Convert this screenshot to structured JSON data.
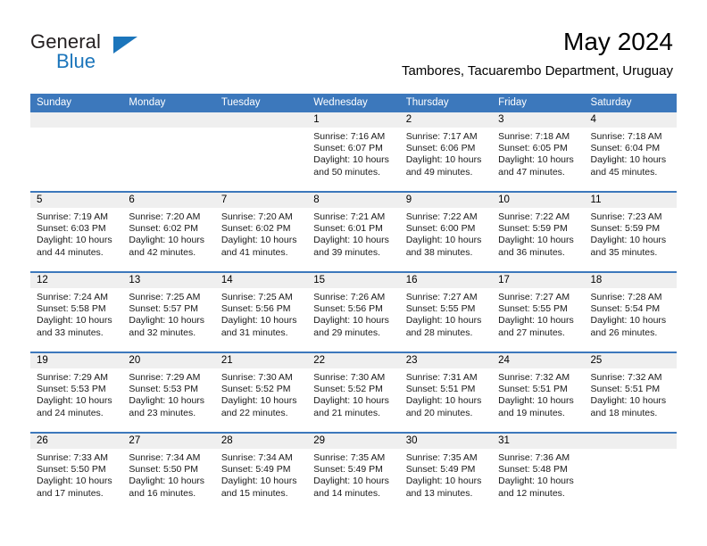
{
  "brand": {
    "name_part1": "General",
    "name_part2": "Blue",
    "accent_color": "#1b75bb"
  },
  "header": {
    "title": "May 2024",
    "subtitle": "Tambores, Tacuarembo Department, Uruguay"
  },
  "theme": {
    "header_bar_color": "#3c78bc",
    "day_number_band_color": "#efefef",
    "text_color": "#000000"
  },
  "weekdays": [
    "Sunday",
    "Monday",
    "Tuesday",
    "Wednesday",
    "Thursday",
    "Friday",
    "Saturday"
  ],
  "weeks": [
    [
      {
        "day": "",
        "sunrise": "",
        "sunset": "",
        "daylight_line1": "",
        "daylight_line2": ""
      },
      {
        "day": "",
        "sunrise": "",
        "sunset": "",
        "daylight_line1": "",
        "daylight_line2": ""
      },
      {
        "day": "",
        "sunrise": "",
        "sunset": "",
        "daylight_line1": "",
        "daylight_line2": ""
      },
      {
        "day": "1",
        "sunrise": "Sunrise: 7:16 AM",
        "sunset": "Sunset: 6:07 PM",
        "daylight_line1": "Daylight: 10 hours",
        "daylight_line2": "and 50 minutes."
      },
      {
        "day": "2",
        "sunrise": "Sunrise: 7:17 AM",
        "sunset": "Sunset: 6:06 PM",
        "daylight_line1": "Daylight: 10 hours",
        "daylight_line2": "and 49 minutes."
      },
      {
        "day": "3",
        "sunrise": "Sunrise: 7:18 AM",
        "sunset": "Sunset: 6:05 PM",
        "daylight_line1": "Daylight: 10 hours",
        "daylight_line2": "and 47 minutes."
      },
      {
        "day": "4",
        "sunrise": "Sunrise: 7:18 AM",
        "sunset": "Sunset: 6:04 PM",
        "daylight_line1": "Daylight: 10 hours",
        "daylight_line2": "and 45 minutes."
      }
    ],
    [
      {
        "day": "5",
        "sunrise": "Sunrise: 7:19 AM",
        "sunset": "Sunset: 6:03 PM",
        "daylight_line1": "Daylight: 10 hours",
        "daylight_line2": "and 44 minutes."
      },
      {
        "day": "6",
        "sunrise": "Sunrise: 7:20 AM",
        "sunset": "Sunset: 6:02 PM",
        "daylight_line1": "Daylight: 10 hours",
        "daylight_line2": "and 42 minutes."
      },
      {
        "day": "7",
        "sunrise": "Sunrise: 7:20 AM",
        "sunset": "Sunset: 6:02 PM",
        "daylight_line1": "Daylight: 10 hours",
        "daylight_line2": "and 41 minutes."
      },
      {
        "day": "8",
        "sunrise": "Sunrise: 7:21 AM",
        "sunset": "Sunset: 6:01 PM",
        "daylight_line1": "Daylight: 10 hours",
        "daylight_line2": "and 39 minutes."
      },
      {
        "day": "9",
        "sunrise": "Sunrise: 7:22 AM",
        "sunset": "Sunset: 6:00 PM",
        "daylight_line1": "Daylight: 10 hours",
        "daylight_line2": "and 38 minutes."
      },
      {
        "day": "10",
        "sunrise": "Sunrise: 7:22 AM",
        "sunset": "Sunset: 5:59 PM",
        "daylight_line1": "Daylight: 10 hours",
        "daylight_line2": "and 36 minutes."
      },
      {
        "day": "11",
        "sunrise": "Sunrise: 7:23 AM",
        "sunset": "Sunset: 5:59 PM",
        "daylight_line1": "Daylight: 10 hours",
        "daylight_line2": "and 35 minutes."
      }
    ],
    [
      {
        "day": "12",
        "sunrise": "Sunrise: 7:24 AM",
        "sunset": "Sunset: 5:58 PM",
        "daylight_line1": "Daylight: 10 hours",
        "daylight_line2": "and 33 minutes."
      },
      {
        "day": "13",
        "sunrise": "Sunrise: 7:25 AM",
        "sunset": "Sunset: 5:57 PM",
        "daylight_line1": "Daylight: 10 hours",
        "daylight_line2": "and 32 minutes."
      },
      {
        "day": "14",
        "sunrise": "Sunrise: 7:25 AM",
        "sunset": "Sunset: 5:56 PM",
        "daylight_line1": "Daylight: 10 hours",
        "daylight_line2": "and 31 minutes."
      },
      {
        "day": "15",
        "sunrise": "Sunrise: 7:26 AM",
        "sunset": "Sunset: 5:56 PM",
        "daylight_line1": "Daylight: 10 hours",
        "daylight_line2": "and 29 minutes."
      },
      {
        "day": "16",
        "sunrise": "Sunrise: 7:27 AM",
        "sunset": "Sunset: 5:55 PM",
        "daylight_line1": "Daylight: 10 hours",
        "daylight_line2": "and 28 minutes."
      },
      {
        "day": "17",
        "sunrise": "Sunrise: 7:27 AM",
        "sunset": "Sunset: 5:55 PM",
        "daylight_line1": "Daylight: 10 hours",
        "daylight_line2": "and 27 minutes."
      },
      {
        "day": "18",
        "sunrise": "Sunrise: 7:28 AM",
        "sunset": "Sunset: 5:54 PM",
        "daylight_line1": "Daylight: 10 hours",
        "daylight_line2": "and 26 minutes."
      }
    ],
    [
      {
        "day": "19",
        "sunrise": "Sunrise: 7:29 AM",
        "sunset": "Sunset: 5:53 PM",
        "daylight_line1": "Daylight: 10 hours",
        "daylight_line2": "and 24 minutes."
      },
      {
        "day": "20",
        "sunrise": "Sunrise: 7:29 AM",
        "sunset": "Sunset: 5:53 PM",
        "daylight_line1": "Daylight: 10 hours",
        "daylight_line2": "and 23 minutes."
      },
      {
        "day": "21",
        "sunrise": "Sunrise: 7:30 AM",
        "sunset": "Sunset: 5:52 PM",
        "daylight_line1": "Daylight: 10 hours",
        "daylight_line2": "and 22 minutes."
      },
      {
        "day": "22",
        "sunrise": "Sunrise: 7:30 AM",
        "sunset": "Sunset: 5:52 PM",
        "daylight_line1": "Daylight: 10 hours",
        "daylight_line2": "and 21 minutes."
      },
      {
        "day": "23",
        "sunrise": "Sunrise: 7:31 AM",
        "sunset": "Sunset: 5:51 PM",
        "daylight_line1": "Daylight: 10 hours",
        "daylight_line2": "and 20 minutes."
      },
      {
        "day": "24",
        "sunrise": "Sunrise: 7:32 AM",
        "sunset": "Sunset: 5:51 PM",
        "daylight_line1": "Daylight: 10 hours",
        "daylight_line2": "and 19 minutes."
      },
      {
        "day": "25",
        "sunrise": "Sunrise: 7:32 AM",
        "sunset": "Sunset: 5:51 PM",
        "daylight_line1": "Daylight: 10 hours",
        "daylight_line2": "and 18 minutes."
      }
    ],
    [
      {
        "day": "26",
        "sunrise": "Sunrise: 7:33 AM",
        "sunset": "Sunset: 5:50 PM",
        "daylight_line1": "Daylight: 10 hours",
        "daylight_line2": "and 17 minutes."
      },
      {
        "day": "27",
        "sunrise": "Sunrise: 7:34 AM",
        "sunset": "Sunset: 5:50 PM",
        "daylight_line1": "Daylight: 10 hours",
        "daylight_line2": "and 16 minutes."
      },
      {
        "day": "28",
        "sunrise": "Sunrise: 7:34 AM",
        "sunset": "Sunset: 5:49 PM",
        "daylight_line1": "Daylight: 10 hours",
        "daylight_line2": "and 15 minutes."
      },
      {
        "day": "29",
        "sunrise": "Sunrise: 7:35 AM",
        "sunset": "Sunset: 5:49 PM",
        "daylight_line1": "Daylight: 10 hours",
        "daylight_line2": "and 14 minutes."
      },
      {
        "day": "30",
        "sunrise": "Sunrise: 7:35 AM",
        "sunset": "Sunset: 5:49 PM",
        "daylight_line1": "Daylight: 10 hours",
        "daylight_line2": "and 13 minutes."
      },
      {
        "day": "31",
        "sunrise": "Sunrise: 7:36 AM",
        "sunset": "Sunset: 5:48 PM",
        "daylight_line1": "Daylight: 10 hours",
        "daylight_line2": "and 12 minutes."
      },
      {
        "day": "",
        "sunrise": "",
        "sunset": "",
        "daylight_line1": "",
        "daylight_line2": ""
      }
    ]
  ]
}
